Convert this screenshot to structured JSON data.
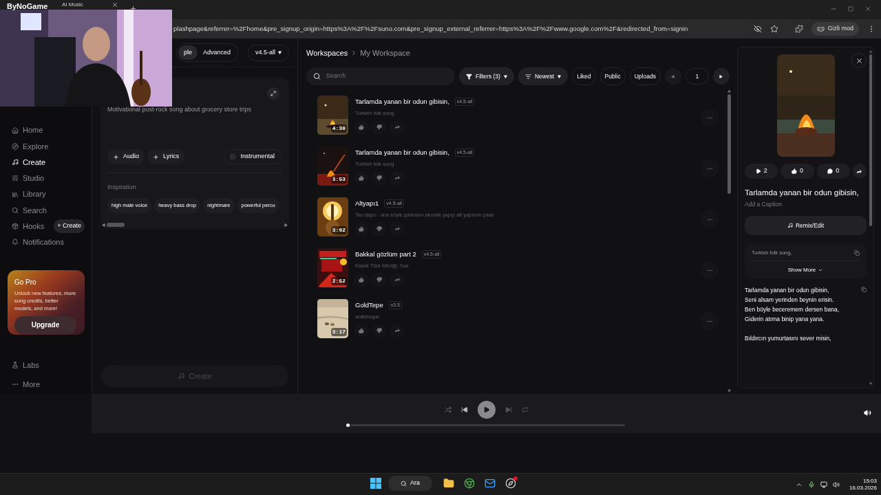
{
  "overlay": {
    "label": "ByNoGame"
  },
  "browser": {
    "tab_title": "AI Music",
    "url": "plashpage&referrer=%2Fhome&pre_signup_origin=https%3A%2F%2Fsuno.com&pre_signup_external_referrer=https%3A%2F%2Fwww.google.com%2F&redirected_from=signin",
    "incognito_label": "Gizli mod"
  },
  "sidebar": {
    "items": [
      {
        "label": "Home",
        "selected": false
      },
      {
        "label": "Explore",
        "selected": false
      },
      {
        "label": "Create",
        "selected": true
      },
      {
        "label": "Studio",
        "selected": false
      },
      {
        "label": "Library",
        "selected": false
      },
      {
        "label": "Search",
        "selected": false
      },
      {
        "label": "Hooks",
        "selected": false,
        "badge": "+ Create"
      },
      {
        "label": "Notifications",
        "selected": false
      }
    ],
    "promo": {
      "title": "Go Pro",
      "text": "Unlock new features, more song credits, better models, and more!",
      "button": "Upgrade"
    },
    "bottom_items": [
      {
        "label": "Labs"
      },
      {
        "label": "More"
      }
    ]
  },
  "create_panel": {
    "mode_tabs": [
      {
        "label": "ple",
        "selected": true
      },
      {
        "label": "Advanced",
        "selected": false
      }
    ],
    "model": "v4.5-all",
    "prompt": "Motivational post-rock song about grocery store trips",
    "add_buttons": [
      "Audio",
      "Lyrics"
    ],
    "instrumental": {
      "label": "Instrumental",
      "on": false
    },
    "inspiration_label": "Inspiration",
    "tags": [
      "high male voice",
      "heavy bass drop",
      "nightmare",
      "powerful percu"
    ],
    "create_button": "Create"
  },
  "workspace": {
    "breadcrumb": [
      "Workspaces",
      "My Workspace"
    ],
    "search_placeholder": "Search",
    "filters": "Filters (3)",
    "sort": "Newest",
    "toggles": [
      "Liked",
      "Public",
      "Uploads"
    ],
    "page": "1",
    "songs": [
      {
        "title": "Tarlamda yanan bir odun gibisin,",
        "model": "v4.5-all",
        "description": "Turkish folk song",
        "duration": "4:30"
      },
      {
        "title": "Tarlamda yanan bir odun gibisin,",
        "model": "v4.5-all",
        "description": "Turkish folk song",
        "duration": "3:53"
      },
      {
        "title": "Altyapı1",
        "model": "v4.5-all",
        "description": "Tan taşcı - ona söyle şarkısını akustik yapıp alt yapısını çıkar",
        "duration": "3:02"
      },
      {
        "title": "Bakkal gözlüm part 2",
        "model": "v4.5-all",
        "description": "Klasik Türk Müziği, Saz",
        "duration": "2:52"
      },
      {
        "title": "GoldTepe",
        "model": "v3.5",
        "description": "arabesque",
        "duration": "3:17"
      }
    ]
  },
  "detail": {
    "plays": "2",
    "likes": "0",
    "comments": "0",
    "title": "Tarlamda yanan bir odun gibisin,",
    "caption": "Add a Caption",
    "remix": "Remix/Edit",
    "style": "Turkish folk song,",
    "show_more": "Show More",
    "lyrics": [
      [
        "Tarlamda yanan bir odun gibisin,",
        "Seni alsam yerinden beynin erisin.",
        "Ben böyle beceremem dersen bana,",
        "Giderin atıma binip yana yana."
      ],
      [
        "Bıldırcın yumurtasını sever misin,"
      ]
    ]
  },
  "player": {
    "level": 0
  },
  "taskbar": {
    "search": "Ara",
    "time": "15:03",
    "date": "16.03.2026"
  }
}
